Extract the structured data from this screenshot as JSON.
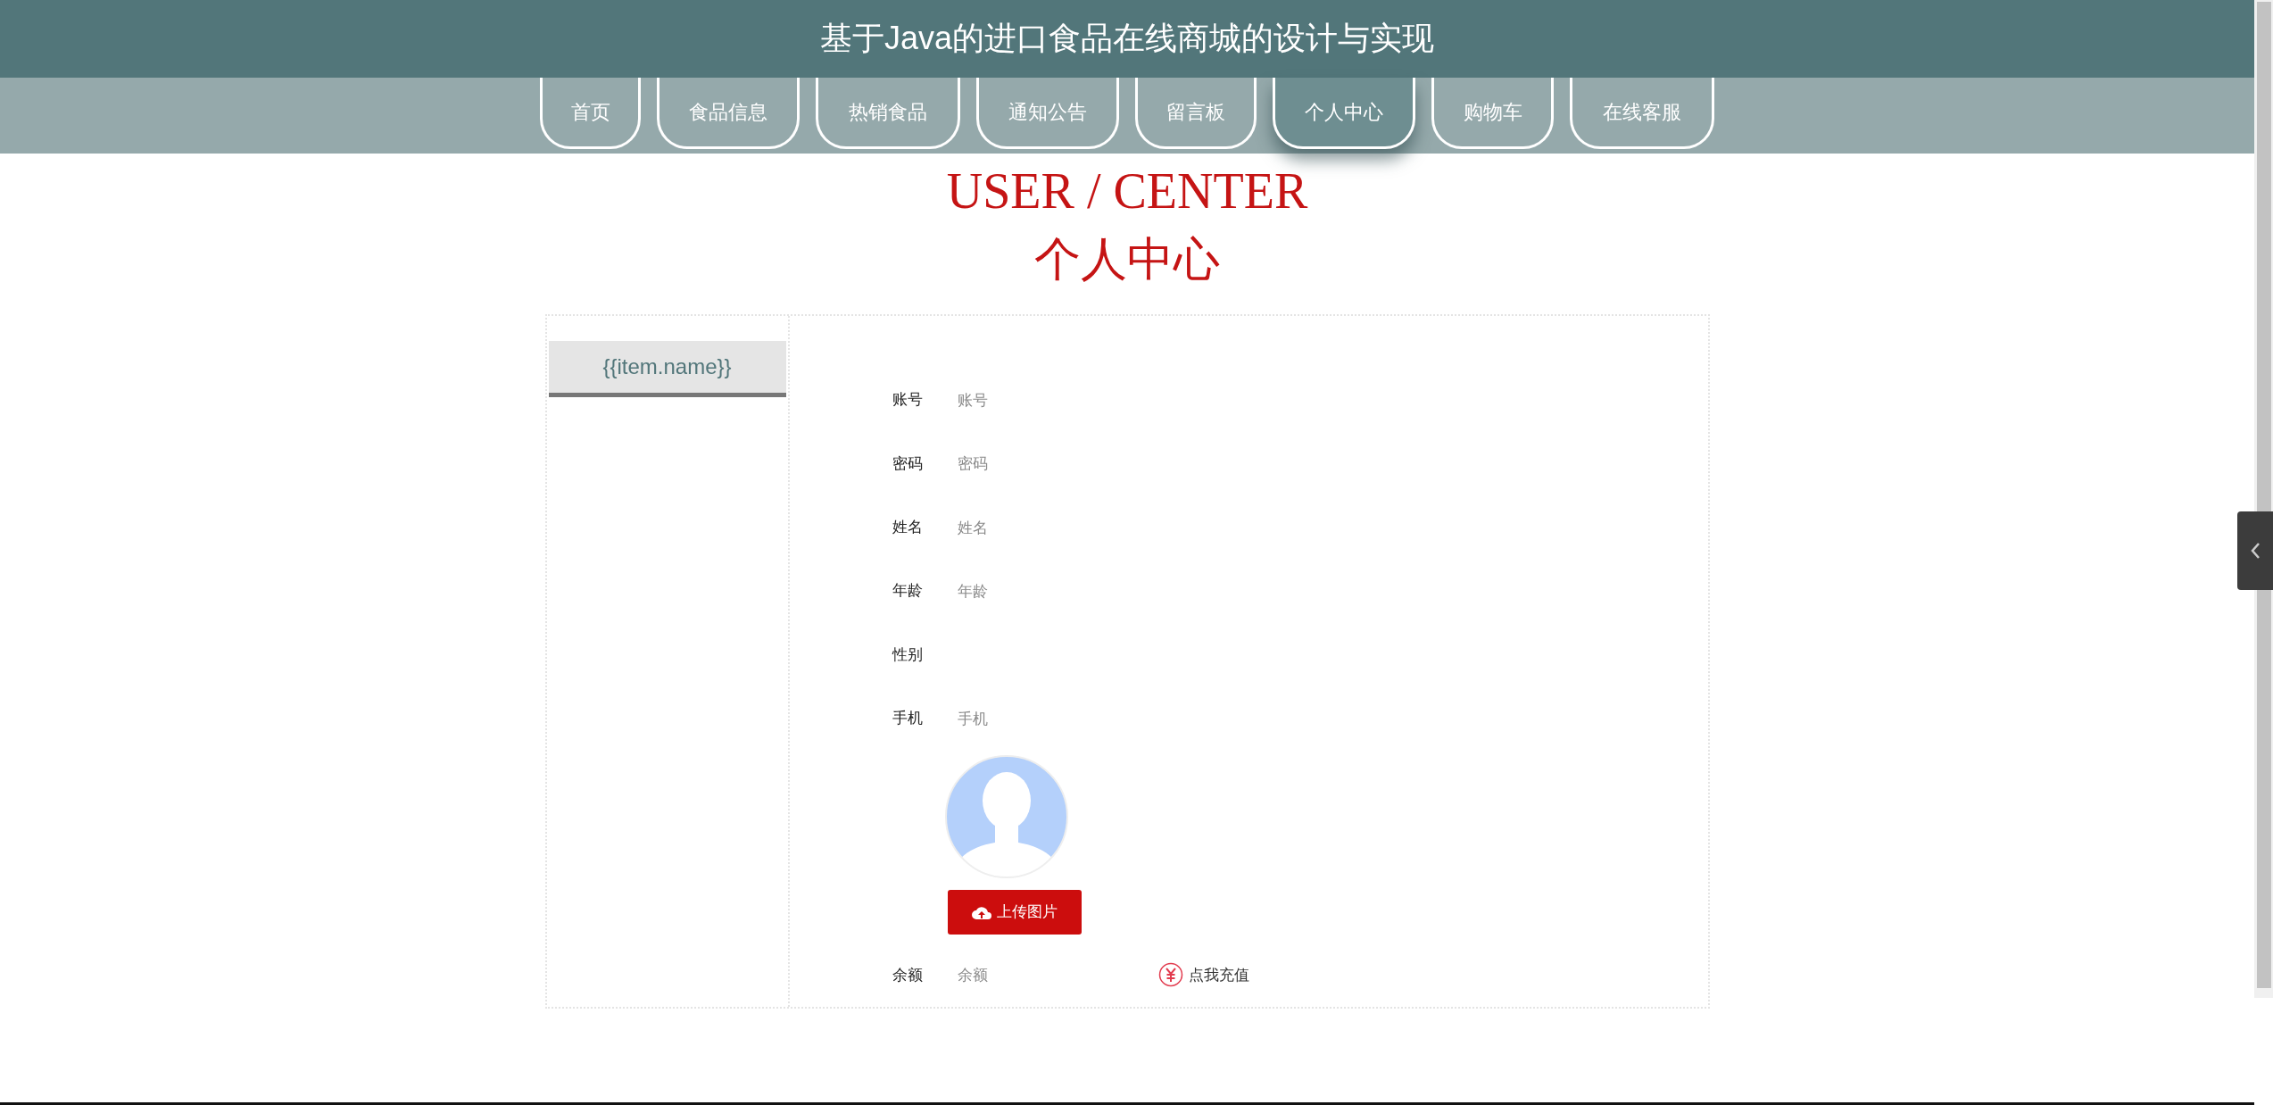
{
  "header": {
    "title": "基于Java的进口食品在线商城的设计与实现"
  },
  "nav": [
    {
      "label": "首页",
      "selected": false
    },
    {
      "label": "食品信息",
      "selected": false
    },
    {
      "label": "热销食品",
      "selected": false
    },
    {
      "label": "通知公告",
      "selected": false
    },
    {
      "label": "留言板",
      "selected": false
    },
    {
      "label": "个人中心",
      "selected": true
    },
    {
      "label": "购物车",
      "selected": false
    },
    {
      "label": "在线客服",
      "selected": false
    }
  ],
  "page_title": {
    "english": "USER / CENTER",
    "chinese": "个人中心"
  },
  "sidebar": {
    "items": [
      {
        "label": "{{item.name}}",
        "selected": true
      }
    ]
  },
  "form": {
    "fields": [
      {
        "kind": "text",
        "label": "账号",
        "placeholder": "账号"
      },
      {
        "kind": "text",
        "label": "密码",
        "placeholder": "密码"
      },
      {
        "kind": "text",
        "label": "姓名",
        "placeholder": "姓名"
      },
      {
        "kind": "text",
        "label": "年龄",
        "placeholder": "年龄"
      },
      {
        "kind": "select",
        "label": "性别"
      },
      {
        "kind": "text",
        "label": "手机",
        "placeholder": "手机"
      },
      {
        "kind": "avatar",
        "button": "上传图片"
      },
      {
        "kind": "balance",
        "label": "余额",
        "placeholder": "余额",
        "action": "点我充值"
      }
    ]
  }
}
